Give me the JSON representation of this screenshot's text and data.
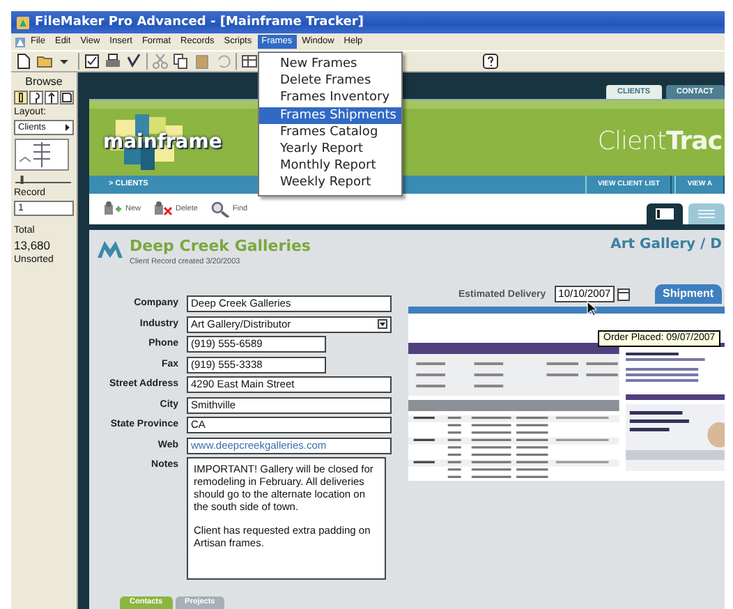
{
  "window": {
    "title": "FileMaker Pro Advanced - [Mainframe Tracker]"
  },
  "menu_bar": [
    {
      "label": "File",
      "selected": false
    },
    {
      "label": "Edit",
      "selected": false
    },
    {
      "label": "View",
      "selected": false
    },
    {
      "label": "Insert",
      "selected": false
    },
    {
      "label": "Format",
      "selected": false
    },
    {
      "label": "Records",
      "selected": false
    },
    {
      "label": "Scripts",
      "selected": false
    },
    {
      "label": "Frames",
      "selected": true
    },
    {
      "label": "Window",
      "selected": false
    },
    {
      "label": "Help",
      "selected": false
    }
  ],
  "dropdown": {
    "items": [
      {
        "label": "New Frames",
        "selected": false
      },
      {
        "label": "Delete Frames",
        "selected": false
      },
      {
        "label": "Frames Inventory",
        "selected": false
      },
      {
        "label": "Frames Shipments",
        "selected": true
      },
      {
        "label": "Frames Catalog",
        "selected": false
      },
      {
        "label": "Yearly Report",
        "selected": false
      },
      {
        "label": "Monthly Report",
        "selected": false
      },
      {
        "label": "Weekly Report",
        "selected": false
      }
    ]
  },
  "status_pane": {
    "mode": "Browse",
    "layout_label": "Layout:",
    "layout": "Clients",
    "record_slider": {
      "level": 0.1
    },
    "record_label": "Record",
    "record": "1",
    "total_label": "Total",
    "total": "13,680",
    "sort_state": "Unsorted"
  },
  "header_tabs": [
    {
      "label": "CLIENTS",
      "selected": true
    },
    {
      "label": "CONTACT",
      "selected": false
    }
  ],
  "banner": {
    "logo": "mainframe",
    "app_name": "Client**Trac**"
  },
  "nav": {
    "breadcrumb": "> CLIENTS",
    "buttons": [
      "VIEW CLIENT LIST",
      "VIEW A"
    ]
  },
  "actions": [
    {
      "label": "New",
      "kind": "new"
    },
    {
      "label": "Delete",
      "kind": "delete"
    },
    {
      "label": "Find",
      "kind": "find"
    }
  ],
  "view_toggle": [
    {
      "kind": "form",
      "selected": true
    },
    {
      "kind": "list",
      "selected": false
    }
  ],
  "record": {
    "name": "Deep Creek Galleries",
    "created_label": "Client Record created",
    "created": "3/20/2003",
    "category": "Art Gallery / D"
  },
  "fields": [
    {
      "label": "Company",
      "value": "Deep Creek Galleries",
      "kind": "text"
    },
    {
      "label": "Industry",
      "value": "Art Gallery/Distributor",
      "kind": "dropdown"
    },
    {
      "label": "Phone",
      "value": "(919) 555-6589",
      "kind": "short"
    },
    {
      "label": "Fax",
      "value": "(919) 555-3338",
      "kind": "short"
    },
    {
      "label": "Street Address",
      "value": "4290 East Main Street",
      "kind": "text"
    },
    {
      "label": "City",
      "value": "Smithville",
      "kind": "text"
    },
    {
      "label": "State Province",
      "value": "CA",
      "kind": "text"
    },
    {
      "label": "Web",
      "value": "www.deepcreekgalleries.com",
      "kind": "link"
    },
    {
      "label": "Notes",
      "paragraphs": [
        "IMPORTANT! Gallery will be closed for remodeling in February. All deliveries should go to the alternate location on the south side of town.",
        "Client has requested extra padding on Artisan frames."
      ],
      "kind": "notes"
    }
  ],
  "delivery": {
    "label": "Estimated Delivery",
    "value": "10/10/2007",
    "tooltip": "Order Placed: 09/07/2007"
  },
  "shipment_tab": {
    "label": "Shipment"
  },
  "bottom_tabs": [
    {
      "label": "Contacts",
      "selected": true
    },
    {
      "label": "Projects",
      "selected": false
    }
  ]
}
